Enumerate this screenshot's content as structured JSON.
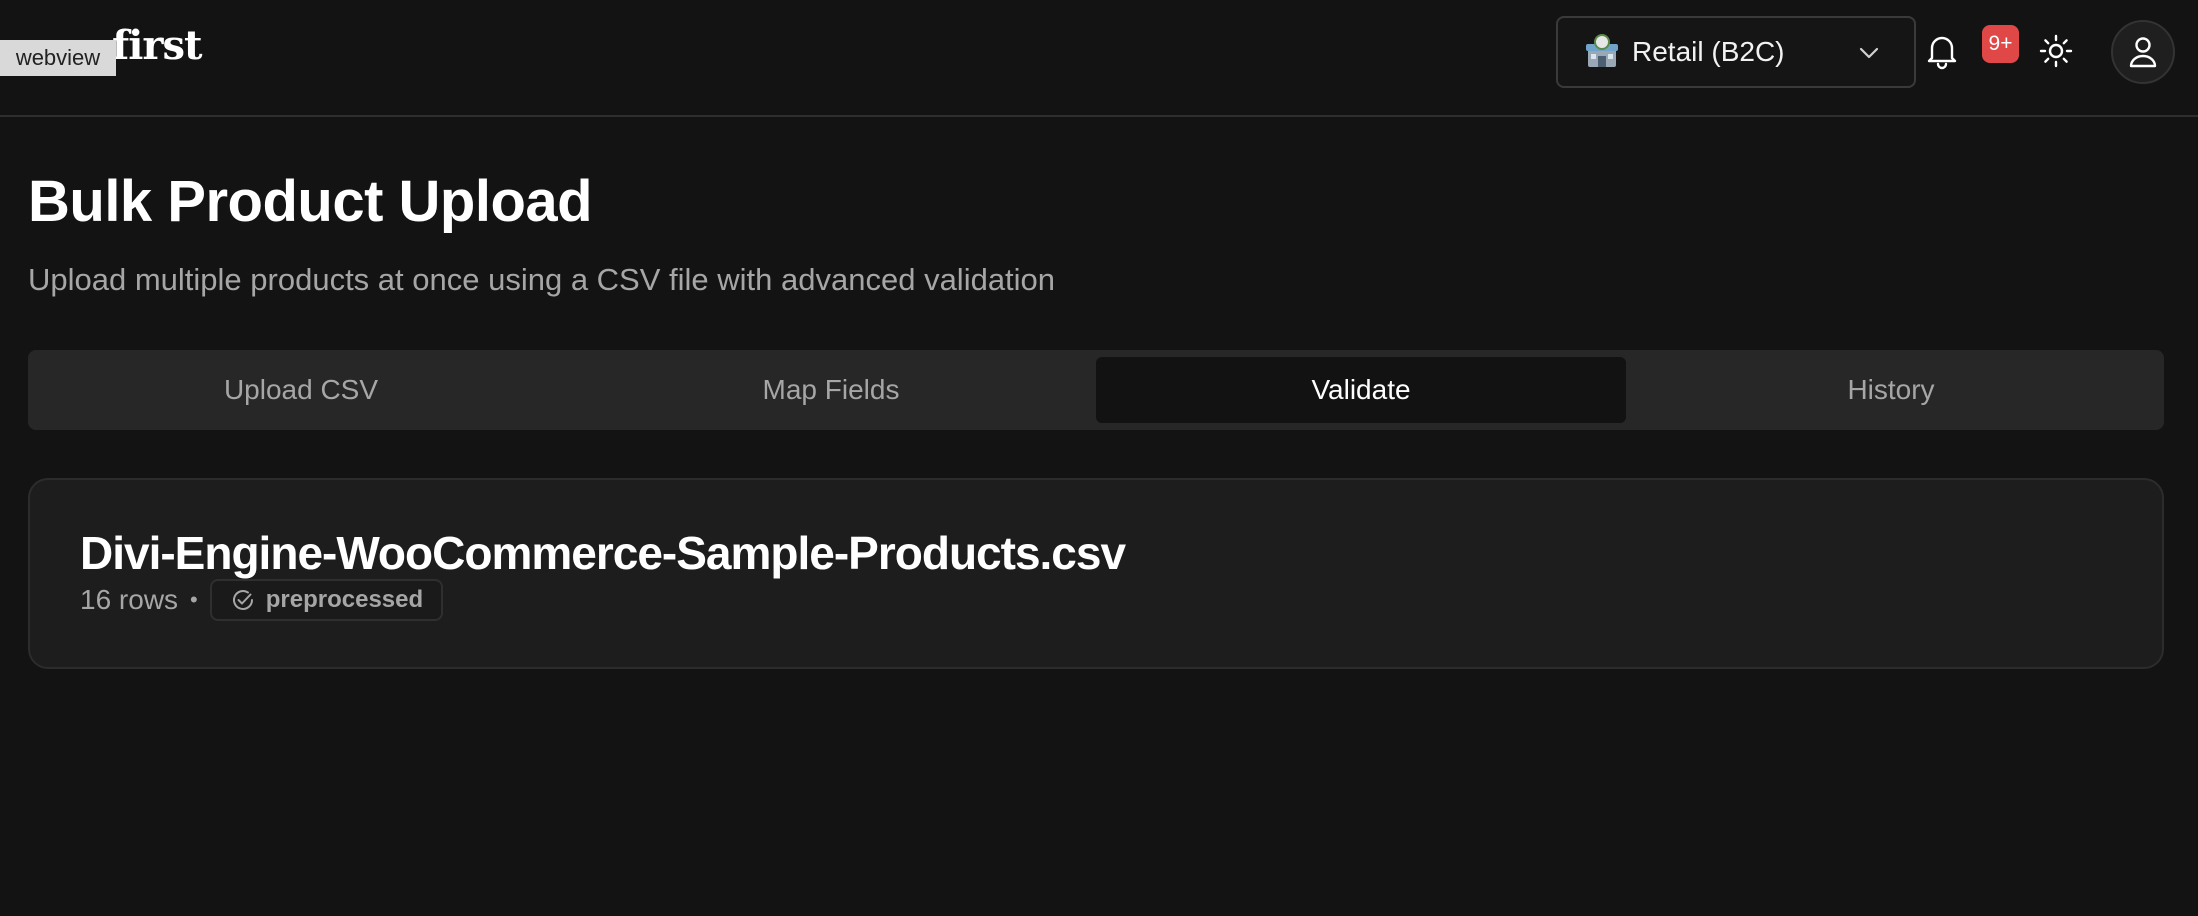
{
  "header": {
    "logo_text": "first",
    "webview_label": "webview",
    "store_selector": {
      "value": "Retail (B2C)",
      "icon": "store-icon"
    },
    "notifications": {
      "icon": "bell-icon",
      "badge": "9+"
    },
    "theme_toggle_icon": "sun-icon",
    "profile_icon": "user-icon"
  },
  "page": {
    "title": "Bulk Product Upload",
    "subtitle": "Upload multiple products at once using a CSV file with advanced validation"
  },
  "tabs": [
    {
      "label": "Upload CSV",
      "active": false
    },
    {
      "label": "Map Fields",
      "active": false
    },
    {
      "label": "Validate",
      "active": true
    },
    {
      "label": "History",
      "active": false
    }
  ],
  "file": {
    "name": "Divi-Engine-WooCommerce-Sample-Products.csv",
    "rows": "16 rows",
    "separator": "•",
    "status": "preprocessed",
    "status_icon": "check-circle-icon"
  },
  "colors": {
    "background": "#131313",
    "card": "#1d1d1d",
    "tab_bar": "#272727",
    "badge": "#e04848",
    "muted_text": "#a6a6a6"
  }
}
